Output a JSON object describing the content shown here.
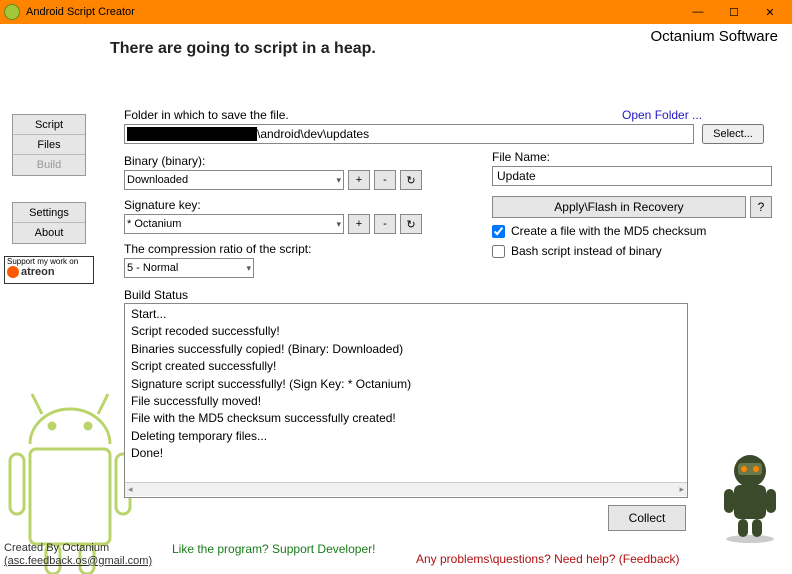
{
  "window": {
    "title": "Android Script Creator",
    "brand": "Octanium Software",
    "heading": "There are going to script in a heap."
  },
  "sidebar": {
    "script": "Script",
    "files": "Files",
    "build": "Build",
    "settings": "Settings",
    "about": "About"
  },
  "patreon": {
    "line1": "Support my work on",
    "word": "atreon"
  },
  "folder": {
    "label": "Folder in which to save the file.",
    "open_link": "Open Folder ...",
    "path_suffix": "\\android\\dev\\updates",
    "select_btn": "Select..."
  },
  "binary": {
    "label": "Binary (binary):",
    "value": "Downloaded",
    "plus": "+",
    "minus": "-",
    "refresh": "↻"
  },
  "sigkey": {
    "label": "Signature key:",
    "value": "* Octanium",
    "plus": "+",
    "minus": "-",
    "refresh": "↻"
  },
  "compression": {
    "label": "The compression ratio of the script:",
    "value": "5 - Normal"
  },
  "filename": {
    "label": "File Name:",
    "value": "Update"
  },
  "apply": {
    "btn": "Apply\\Flash in Recovery",
    "help": "?"
  },
  "checks": {
    "md5_label": "Create a file with the MD5 checksum",
    "md5_checked": true,
    "bash_label": "Bash script instead of binary",
    "bash_checked": false
  },
  "status": {
    "label": "Build Status",
    "lines": [
      "Start...",
      "Script recoded successfully!",
      "Binaries successfully copied! (Binary: Downloaded)",
      "Script created successfully!",
      "Signature script successfully! (Sign Key: * Octanium)",
      "File successfully moved!",
      "File with the MD5 checksum successfully created!",
      "Deleting temporary files...",
      "Done!"
    ]
  },
  "collect_btn": "Collect",
  "credits": {
    "line1": "Created By Octanium",
    "email": "(asc.feedback.os@gmail.com)"
  },
  "support_dev": "Like the program? Support Developer!",
  "feedback": "Any problems\\questions? Need help? (Feedback)"
}
